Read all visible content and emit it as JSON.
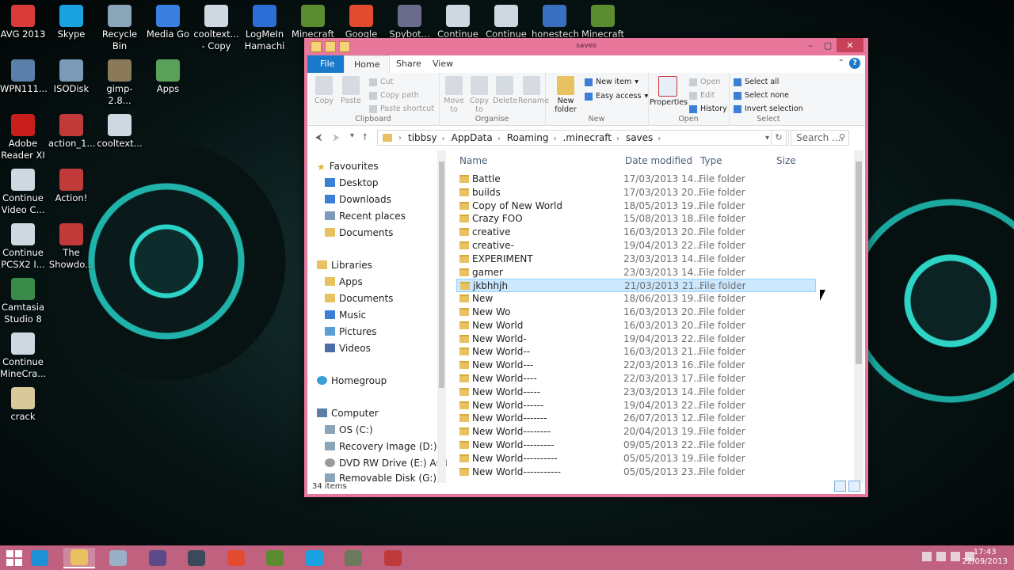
{
  "desktop_icons": [
    {
      "label": "AVG 2013",
      "icon": "avg-icon",
      "color": "#d93b3b"
    },
    {
      "label": "Skype",
      "icon": "skype-icon",
      "color": "#1aa2e0"
    },
    {
      "label": "Recycle Bin",
      "icon": "recycle-bin-icon",
      "color": "#8aa4b8"
    },
    {
      "label": "Media Go",
      "icon": "media-go-icon",
      "color": "#3a7ee0"
    },
    {
      "label": "cooltext... - Copy",
      "icon": "file-icon",
      "color": "#cfd8e0"
    },
    {
      "label": "LogMeIn Hamachi",
      "icon": "hamachi-icon",
      "color": "#2b6fd6"
    },
    {
      "label": "Minecraft",
      "icon": "minecraft-icon",
      "color": "#5b8c2f"
    },
    {
      "label": "Google",
      "icon": "chrome-icon",
      "color": "#e34b2f"
    },
    {
      "label": "Spybot...",
      "icon": "spybot-icon",
      "color": "#6b6b8c"
    },
    {
      "label": "Continue",
      "icon": "file-icon",
      "color": "#cfd8e0"
    },
    {
      "label": "Continue",
      "icon": "file-icon",
      "color": "#cfd8e0"
    },
    {
      "label": "honestech",
      "icon": "honestech-icon",
      "color": "#3a6fc0"
    },
    {
      "label": "Minecraft",
      "icon": "minecraft-icon",
      "color": "#5b8c2f"
    },
    {
      "label": "WPN111...",
      "icon": "network-icon",
      "color": "#5a7fa8"
    },
    {
      "label": "ISODisk",
      "icon": "disk-icon",
      "color": "#7a9ab8"
    },
    {
      "label": "gimp-2.8...",
      "icon": "gimp-icon",
      "color": "#8a7a5a"
    },
    {
      "label": "Apps",
      "icon": "apps-icon",
      "color": "#5aa05a"
    },
    {
      "label": "Adobe Reader XI",
      "icon": "adobe-reader-icon",
      "color": "#c81e1e"
    },
    {
      "label": "action_1...",
      "icon": "action-icon",
      "color": "#c03a3a"
    },
    {
      "label": "cooltext...",
      "icon": "file-icon",
      "color": "#cfd8e0"
    },
    {
      "label": "Continue Video C...",
      "icon": "file-icon",
      "color": "#cfd8e0"
    },
    {
      "label": "Action!",
      "icon": "action-icon",
      "color": "#c03a3a"
    },
    {
      "label": "Continue PCSX2 I...",
      "icon": "file-icon",
      "color": "#cfd8e0"
    },
    {
      "label": "The Showdo...",
      "icon": "showdown-icon",
      "color": "#c03a3a"
    },
    {
      "label": "Camtasia Studio 8",
      "icon": "camtasia-icon",
      "color": "#3a8a4a"
    },
    {
      "label": "Continue MineCra...",
      "icon": "file-icon",
      "color": "#cfd8e0"
    },
    {
      "label": "crack",
      "icon": "file-icon",
      "color": "#d9c89a"
    }
  ],
  "window": {
    "title": "saves",
    "tabs": {
      "file": "File",
      "home": "Home",
      "share": "Share",
      "view": "View"
    },
    "ribbon": {
      "clipboard": {
        "label": "Clipboard",
        "copy": "Copy",
        "paste": "Paste",
        "cut": "Cut",
        "copy_path": "Copy path",
        "paste_shortcut": "Paste shortcut"
      },
      "organise": {
        "label": "Organise",
        "move_to": "Move to",
        "copy_to": "Copy to",
        "delete": "Delete",
        "rename": "Rename"
      },
      "new": {
        "label": "New",
        "new_folder": "New folder",
        "new_item": "New item",
        "easy_access": "Easy access"
      },
      "open": {
        "label": "Open",
        "properties": "Properties",
        "open": "Open",
        "edit": "Edit",
        "history": "History"
      },
      "select": {
        "label": "Select",
        "select_all": "Select all",
        "select_none": "Select none",
        "invert_selection": "Invert selection"
      }
    },
    "breadcrumbs": [
      "tibbsy",
      "AppData",
      "Roaming",
      ".minecraft",
      "saves"
    ],
    "search_placeholder": "Search ...",
    "nav": {
      "favourites": "Favourites",
      "desktop": "Desktop",
      "downloads": "Downloads",
      "recent_places": "Recent places",
      "documents": "Documents",
      "libraries": "Libraries",
      "apps": "Apps",
      "lib_documents": "Documents",
      "music": "Music",
      "pictures": "Pictures",
      "videos": "Videos",
      "homegroup": "Homegroup",
      "computer": "Computer",
      "os_c": "OS (C:)",
      "recovery_d": "Recovery Image (D:)",
      "dvd_e": "DVD RW Drive (E:) Aud",
      "removable_g": "Removable Disk (G:)"
    },
    "columns": {
      "name": "Name",
      "date": "Date modified",
      "type": "Type",
      "size": "Size"
    },
    "files": [
      {
        "name": "Battle",
        "date": "17/03/2013 14...",
        "type": "File folder"
      },
      {
        "name": "builds",
        "date": "17/03/2013 20...",
        "type": "File folder"
      },
      {
        "name": "Copy of New World",
        "date": "18/05/2013 19...",
        "type": "File folder"
      },
      {
        "name": "Crazy FOO",
        "date": "15/08/2013 18...",
        "type": "File folder"
      },
      {
        "name": "creative",
        "date": "16/03/2013 20...",
        "type": "File folder"
      },
      {
        "name": "creative-",
        "date": "19/04/2013 22...",
        "type": "File folder"
      },
      {
        "name": "EXPERIMENT",
        "date": "23/03/2013 14...",
        "type": "File folder"
      },
      {
        "name": "gamer",
        "date": "23/03/2013 14...",
        "type": "File folder"
      },
      {
        "name": "jkbhhjh",
        "date": "21/03/2013 21...",
        "type": "File folder",
        "selected": true
      },
      {
        "name": "New",
        "date": "18/06/2013 19...",
        "type": "File folder"
      },
      {
        "name": "New Wo",
        "date": "16/03/2013 20...",
        "type": "File folder"
      },
      {
        "name": "New World",
        "date": "16/03/2013 20...",
        "type": "File folder"
      },
      {
        "name": "New World-",
        "date": "19/04/2013 22...",
        "type": "File folder"
      },
      {
        "name": "New World--",
        "date": "16/03/2013 21...",
        "type": "File folder"
      },
      {
        "name": "New World---",
        "date": "22/03/2013 16...",
        "type": "File folder"
      },
      {
        "name": "New World----",
        "date": "22/03/2013 17...",
        "type": "File folder"
      },
      {
        "name": "New World-----",
        "date": "23/03/2013 14...",
        "type": "File folder"
      },
      {
        "name": "New World------",
        "date": "19/04/2013 22...",
        "type": "File folder"
      },
      {
        "name": "New World-------",
        "date": "26/07/2013 12...",
        "type": "File folder"
      },
      {
        "name": "New World--------",
        "date": "20/04/2013 19...",
        "type": "File folder"
      },
      {
        "name": "New World---------",
        "date": "09/05/2013 22...",
        "type": "File folder"
      },
      {
        "name": "New World----------",
        "date": "05/05/2013 19...",
        "type": "File folder"
      },
      {
        "name": "New World-----------",
        "date": "05/05/2013 23...",
        "type": "File folder"
      }
    ],
    "status": "34 items"
  },
  "taskbar": {
    "items": [
      "ie-icon",
      "file-explorer-icon",
      "paint-icon",
      "media-icon",
      "steam-icon",
      "chrome-icon",
      "minecraft-icon",
      "skype-icon",
      "minecraft-server-icon",
      "recording-icon"
    ],
    "time": "17:43",
    "date": "22/09/2013"
  },
  "colors": {
    "accent": "#1979ca",
    "window_frame": "#e7779b",
    "taskbar": "#c0617f",
    "selection": "#cce8ff"
  }
}
